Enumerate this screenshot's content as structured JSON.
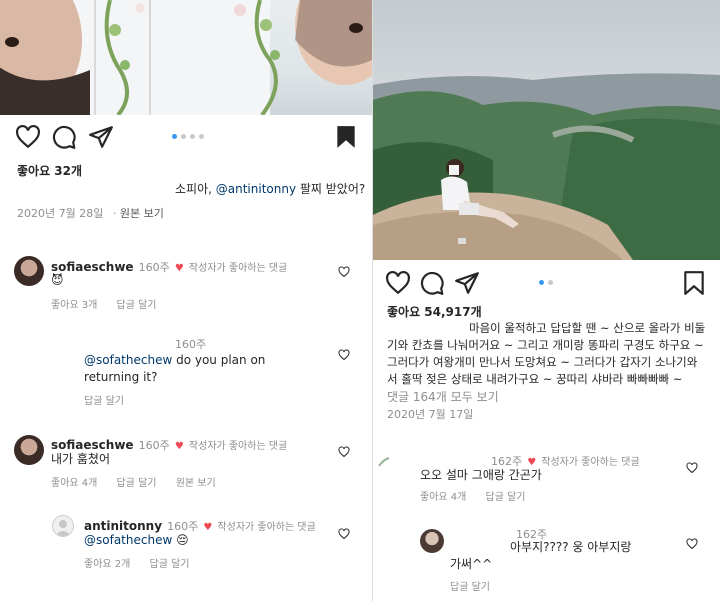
{
  "left_post": {
    "likes": "좋아요 32개",
    "caption_prefix": "소피아, ",
    "caption_mention": "@antinitonny",
    "caption_suffix": " 팔찌 받았어?",
    "date": "2020년 7월 28일",
    "view_original": "원본 보기",
    "comments": [
      {
        "user": "sofiaeschwe",
        "age": "160주",
        "creator_liked": "작성자가 좋아하는 댓글",
        "text": "😈",
        "likes": "좋아요 3개",
        "reply": "답글 달기"
      },
      {
        "age": "160주",
        "mention": "@sofathechew",
        "text": " do you plan on returning it?",
        "reply": "답글 달기"
      },
      {
        "user": "sofiaeschwe",
        "age": "160주",
        "creator_liked": "작성자가 좋아하는 댓글",
        "text": "내가 훔쳤어",
        "likes": "좋아요 4개",
        "reply": "답글 달기",
        "view_original": "원본 보기"
      },
      {
        "user": "antinitonny",
        "age": "160주",
        "creator_liked": "작성자가 좋아하는 댓글",
        "mention": "@sofathechew",
        "text": " 😔",
        "likes": "좋아요 2개",
        "reply": "답글 달기"
      }
    ]
  },
  "right_post": {
    "likes": "좋아요 54,917개",
    "caption_lines": [
      "마음이 울적하고 답답할 땐 ~ 산으로 올라가 비둘",
      "기와 칸쵸를 나눠머거요 ~ 그리고 개미랑 똥파리 구경도 하구요 ~",
      "그러다가 여왕개미 만나서 도망쳐요 ~ 그러다가 갑자기 소나기와",
      "서 홀딱 젖은 상태로 내려가구요 ~ 꿍따리 샤바라 빠빠빠빠 ~"
    ],
    "view_comments": "댓글 164개 모두 보기",
    "date": "2020년 7월 17일",
    "comments": [
      {
        "age": "162주",
        "creator_liked": "작성자가 좋아하는 댓글",
        "text": "오오 설마 그애랑 간곤가",
        "likes": "좋아요 4개",
        "reply": "답글 달기"
      },
      {
        "age": "162주",
        "text_line1": "아부지???? 웅 아부지랑",
        "text_line2": "가써^^",
        "reply": "답글 달기"
      }
    ]
  },
  "colors": {
    "heart": "#ed4956",
    "mention": "#00376b",
    "dot_active": "#3897f0"
  },
  "icons": [
    "heart-icon",
    "comment-icon",
    "share-icon",
    "bookmark-icon"
  ]
}
